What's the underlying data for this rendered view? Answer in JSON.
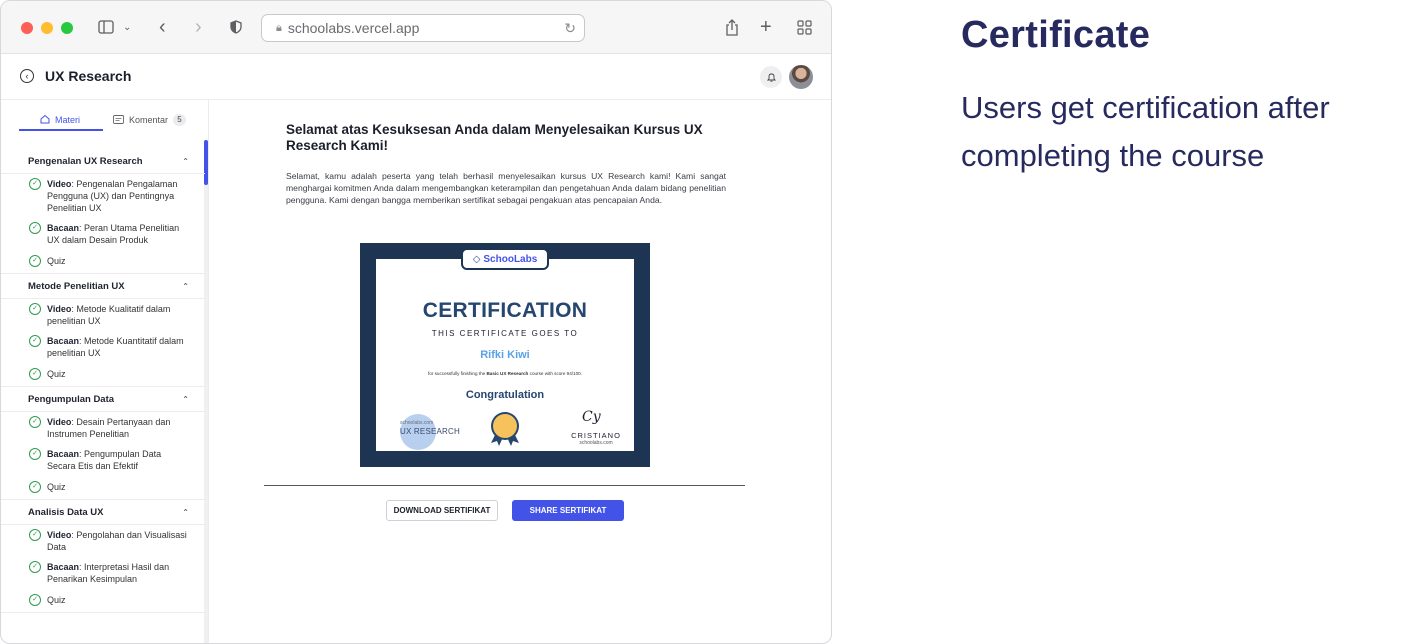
{
  "browser": {
    "url": "schoolabs.vercel.app"
  },
  "app": {
    "title": "UX Research"
  },
  "sidebar": {
    "tabs": [
      {
        "label": "Materi"
      },
      {
        "label": "Komentar",
        "count": "5"
      }
    ],
    "sections": [
      {
        "title": "Pengenalan UX Research",
        "items": [
          {
            "type": "Video",
            "text": ": Pengenalan Pengalaman Pengguna (UX) dan Pentingnya Penelitian UX"
          },
          {
            "type": "Bacaan",
            "text": ": Peran Utama Penelitian UX dalam Desain Produk"
          },
          {
            "type": "",
            "text": "Quiz"
          }
        ]
      },
      {
        "title": "Metode Penelitian UX",
        "items": [
          {
            "type": "Video",
            "text": ": Metode Kualitatif dalam penelitian UX"
          },
          {
            "type": "Bacaan",
            "text": ": Metode Kuantitatif dalam penelitian UX"
          },
          {
            "type": "",
            "text": "Quiz"
          }
        ]
      },
      {
        "title": "Pengumpulan Data",
        "items": [
          {
            "type": "Video",
            "text": ": Desain Pertanyaan dan Instrumen Penelitian"
          },
          {
            "type": "Bacaan",
            "text": ": Pengumpulan Data Secara Etis dan Efektif"
          },
          {
            "type": "",
            "text": "Quiz"
          }
        ]
      },
      {
        "title": "Analisis Data UX",
        "items": [
          {
            "type": "Video",
            "text": ": Pengolahan dan Visualisasi Data"
          },
          {
            "type": "Bacaan",
            "text": ": Interpretasi Hasil dan Penarikan Kesimpulan"
          },
          {
            "type": "",
            "text": "Quiz"
          }
        ]
      }
    ]
  },
  "main": {
    "heading": "Selamat atas Kesuksesan Anda dalam Menyelesaikan Kursus UX Research Kami!",
    "paragraph": "Selamat, kamu adalah peserta yang telah berhasil menyelesaikan kursus UX Research kami! Kami sangat menghargai komitmen Anda dalam mengembangkan keterampilan dan pengetahuan Anda dalam bidang penelitian pengguna. Kami dengan bangga memberikan sertifikat sebagai pengakuan atas pencapaian Anda.",
    "certificate": {
      "brand": "SchooLabs",
      "title": "CERTIFICATION",
      "subtitle": "THIS CERTIFICATE GOES TO",
      "recipient": "Rifki Kiwi",
      "description_pre": "for successfully finishing the ",
      "description_course": "Basic UX Research",
      "description_post": " course with score 94/100.",
      "congrats": "Congratulation",
      "stamp_site": "schoolabs.com",
      "stamp_course": "UX RESEARCH",
      "signature": "Cy",
      "signer": "CRISTIANO",
      "signer_site": "schoolabs.com"
    },
    "buttons": {
      "download": "DOWNLOAD SERTIFIKAT",
      "share": "SHARE SERTIFIKAT"
    }
  },
  "caption": {
    "title": "Certificate",
    "text": "Users get certification after completing the course"
  },
  "colors": {
    "accent": "#4353e8",
    "cert_frame": "#1d3452",
    "caption": "#272a5e",
    "check": "#2e9b4f"
  }
}
